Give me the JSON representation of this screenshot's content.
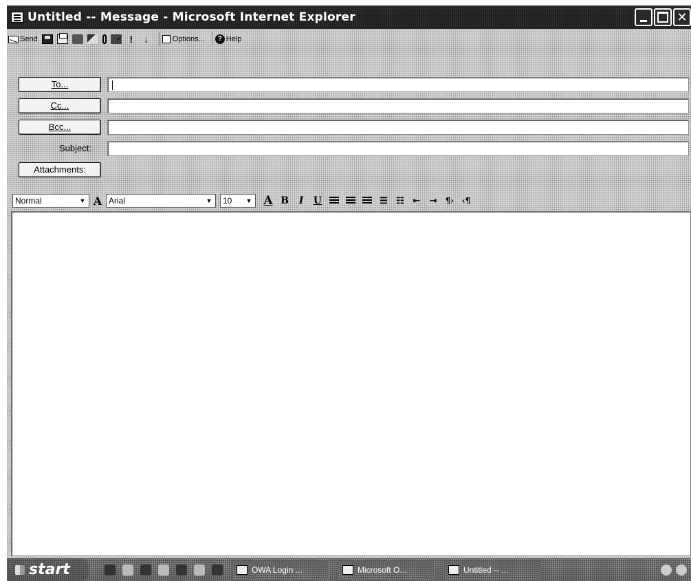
{
  "window": {
    "title": "Untitled -- Message - Microsoft Internet Explorer"
  },
  "toolbar": {
    "send_label": "Send",
    "options_label": "Options...",
    "help_label": "Help",
    "icons": [
      "send-icon",
      "save-icon",
      "print-icon",
      "address-book-icon",
      "check-names-icon",
      "attach-icon",
      "spell-check-icon",
      "importance-high-icon",
      "importance-low-icon",
      "options-icon",
      "help-icon"
    ]
  },
  "header": {
    "to_label": "To...",
    "cc_label": "Cc...",
    "bcc_label": "Bcc...",
    "subject_label": "Subject:",
    "attachments_label": "Attachments:",
    "to_value": "",
    "cc_value": "",
    "bcc_value": "",
    "subject_value": ""
  },
  "format": {
    "style_value": "Normal",
    "font_value": "Arial",
    "size_value": "10",
    "buttons": [
      "font-color-icon",
      "bold-icon",
      "italic-icon",
      "underline-icon",
      "align-left-icon",
      "align-center-icon",
      "align-right-icon",
      "bulleted-list-icon",
      "numbered-list-icon",
      "decrease-indent-icon",
      "increase-indent-icon",
      "ltr-icon",
      "rtl-icon"
    ]
  },
  "taskbar": {
    "start_label": "start",
    "tasks": [
      {
        "label": "OWA Login ..."
      },
      {
        "label": "Microsoft O..."
      },
      {
        "label": "Untitled -- ..."
      }
    ]
  }
}
